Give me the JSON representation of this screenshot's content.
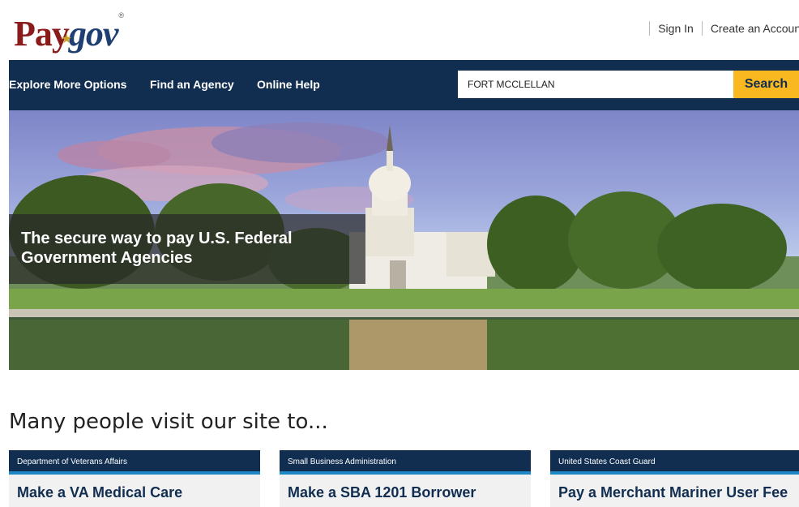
{
  "header": {
    "logo_pay": "Pay",
    "logo_gov": "gov",
    "logo_reg": "®",
    "sign_in": "Sign In",
    "create_account": "Create an Account"
  },
  "nav": {
    "items": [
      "Explore More Options",
      "Find an Agency",
      "Online Help"
    ],
    "search_value": "FORT MCCLELLAN",
    "search_button": "Search"
  },
  "hero": {
    "caption": "The secure way to pay U.S. Federal Government Agencies"
  },
  "section": {
    "title": "Many people visit our site to...",
    "cards": [
      {
        "agency": "Department of Veterans Affairs",
        "title": "Make a VA Medical Care"
      },
      {
        "agency": "Small Business Administration",
        "title": "Make a SBA 1201 Borrower"
      },
      {
        "agency": "United States Coast Guard",
        "title": "Pay a Merchant Mariner User Fee"
      }
    ]
  },
  "colors": {
    "nav_bg": "#112e51",
    "search_button": "#f9b81f",
    "card_accent": "#1e87c6",
    "logo_pay": "#8a1b1b",
    "logo_gov": "#1f3f72"
  }
}
